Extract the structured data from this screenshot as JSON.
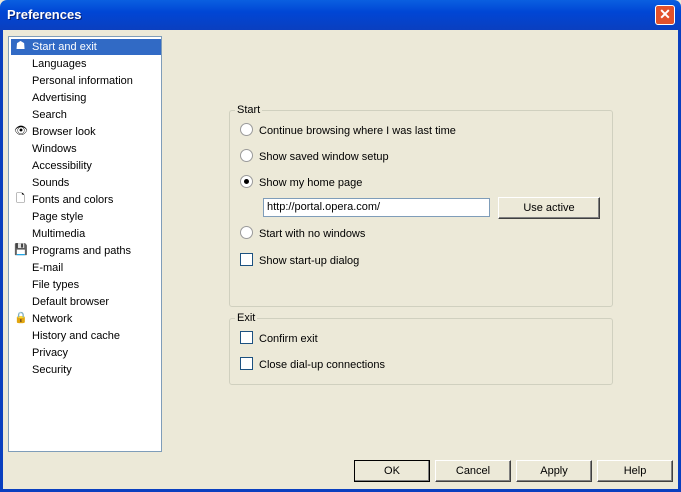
{
  "window": {
    "title": "Preferences",
    "close": "✕"
  },
  "sidebar": {
    "items": [
      {
        "label": "Start and exit",
        "icon": "person-icon",
        "selected": true
      },
      {
        "label": "Languages"
      },
      {
        "label": "Personal information"
      },
      {
        "label": "Advertising"
      },
      {
        "label": "Search"
      },
      {
        "label": "Browser look",
        "icon": "eye-icon"
      },
      {
        "label": "Windows"
      },
      {
        "label": "Accessibility"
      },
      {
        "label": "Sounds"
      },
      {
        "label": "Fonts and colors",
        "icon": "page-icon"
      },
      {
        "label": "Page style"
      },
      {
        "label": "Multimedia"
      },
      {
        "label": "Programs and paths",
        "icon": "floppy-icon"
      },
      {
        "label": "E-mail"
      },
      {
        "label": "File types"
      },
      {
        "label": "Default browser"
      },
      {
        "label": "Network",
        "icon": "lock-icon"
      },
      {
        "label": "History and cache"
      },
      {
        "label": "Privacy"
      },
      {
        "label": "Security"
      }
    ]
  },
  "start": {
    "legend": "Start",
    "continue": "Continue browsing where I was last time",
    "saved": "Show saved window setup",
    "home": "Show my home page",
    "home_url": "http://portal.opera.com/",
    "use_active": "Use active",
    "no_windows": "Start with no windows",
    "startup_dialog": "Show start-up dialog"
  },
  "exit": {
    "legend": "Exit",
    "confirm": "Confirm exit",
    "close_dialup": "Close dial-up connections"
  },
  "buttons": {
    "ok": "OK",
    "cancel": "Cancel",
    "apply": "Apply",
    "help": "Help"
  }
}
